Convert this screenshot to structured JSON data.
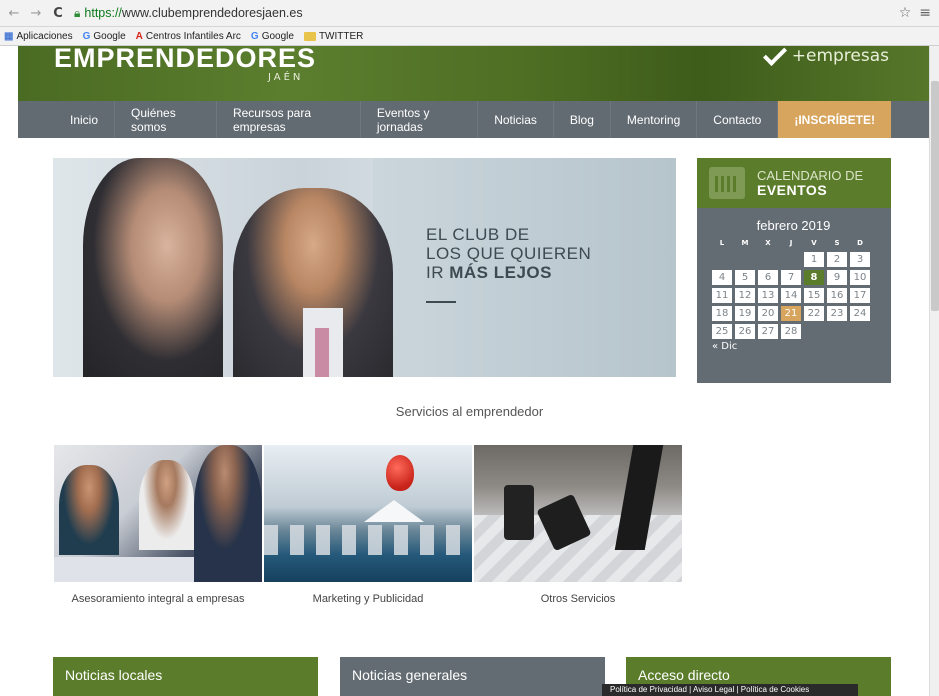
{
  "browser": {
    "url_prefix": "https://",
    "url_rest": "www.clubemprendedoresjaen.es",
    "bookmarks": [
      {
        "label": "Aplicaciones",
        "icon": "apps-icon"
      },
      {
        "label": "Google",
        "icon": "google-icon"
      },
      {
        "label": "Centros Infantiles Arc",
        "icon": "adobe-icon"
      },
      {
        "label": "Google",
        "icon": "google-icon"
      },
      {
        "label": "TWITTER",
        "icon": "folder-icon"
      }
    ]
  },
  "header": {
    "logo": "EMPRENDEDORES",
    "logo_sub": "JAÉN",
    "right_text": "+empresas"
  },
  "nav": {
    "items": [
      "Inicio",
      "Quiénes somos",
      "Recursos para empresas",
      "Eventos y jornadas",
      "Noticias",
      "Blog",
      "Mentoring",
      "Contacto"
    ],
    "cta": "¡INSCRÍBETE!"
  },
  "hero": {
    "line1": "EL CLUB DE",
    "line2": "LOS QUE QUIEREN",
    "line3_pre": "IR ",
    "line3_bold": "MÁS LEJOS"
  },
  "calendar": {
    "title_small": "CALENDARIO DE",
    "title_bold": "EVENTOS",
    "month": "febrero 2019",
    "weekdays": [
      "L",
      "M",
      "X",
      "J",
      "V",
      "S",
      "D"
    ],
    "leading_blanks": 4,
    "days": [
      "1",
      "2",
      "3",
      "4",
      "5",
      "6",
      "7",
      "8",
      "9",
      "10",
      "11",
      "12",
      "13",
      "14",
      "15",
      "16",
      "17",
      "18",
      "19",
      "20",
      "21",
      "22",
      "23",
      "24",
      "25",
      "26",
      "27",
      "28"
    ],
    "event_day": "8",
    "today": "21",
    "prev_link": "« Dic"
  },
  "services": {
    "title": "Servicios al emprendedor",
    "items": [
      "Asesoramiento integral a empresas",
      "Marketing y Publicidad",
      "Otros Servicios"
    ]
  },
  "boxes": [
    "Noticias locales",
    "Noticias generales",
    "Acceso directo"
  ],
  "cookie_bar": "Política de Privacidad | Aviso Legal | Política de Cookies",
  "colors": {
    "green": "#5b7d2b",
    "gray": "#646c73",
    "accent": "#d8a55e"
  }
}
